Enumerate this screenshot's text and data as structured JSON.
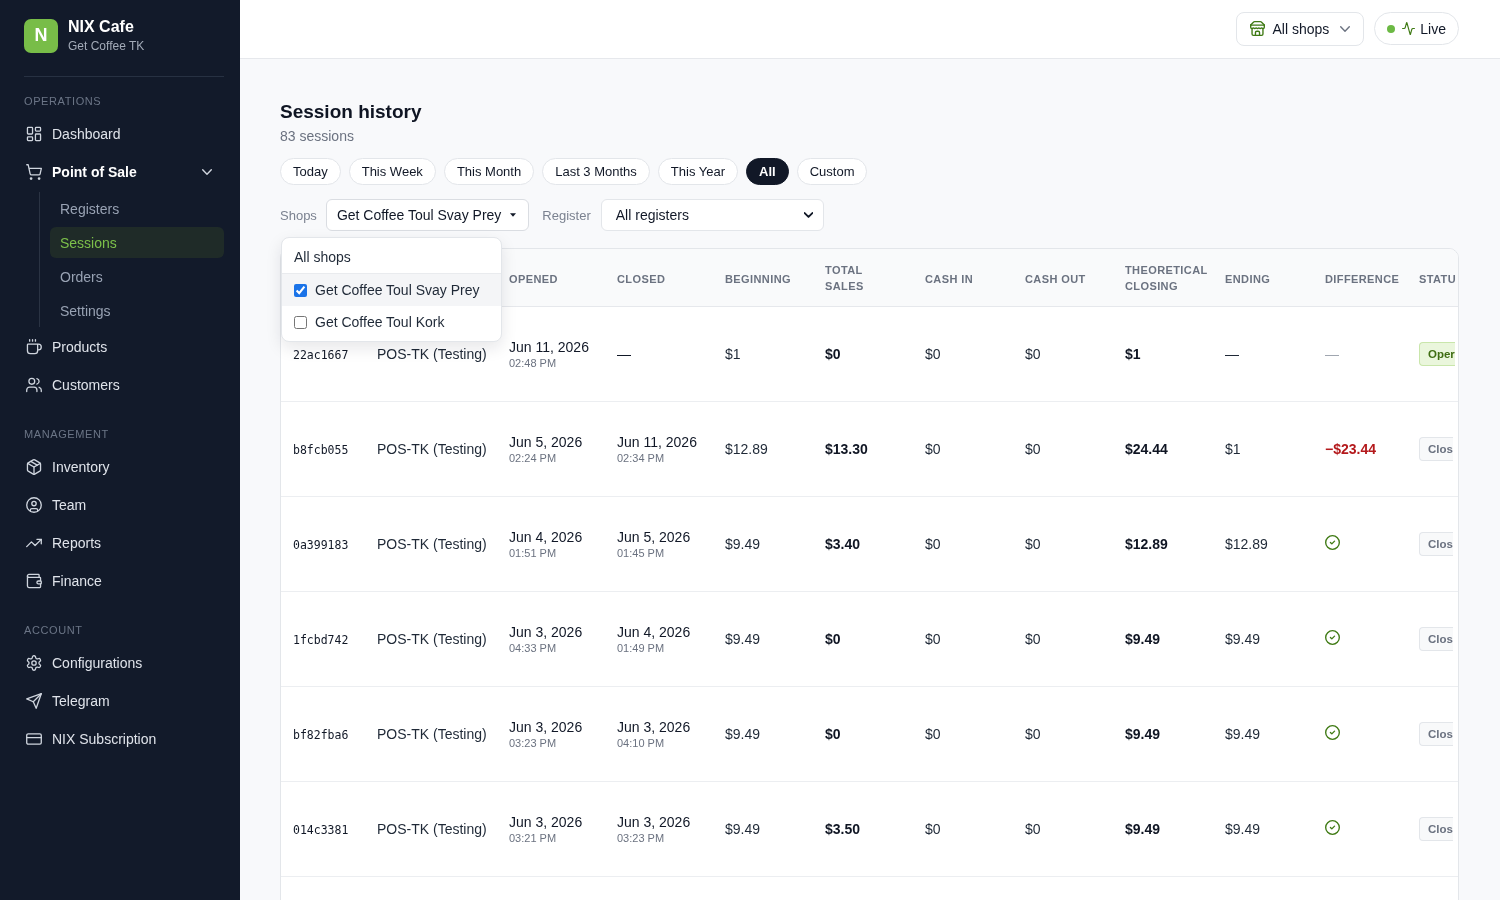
{
  "sidebar": {
    "brand": {
      "logo_letter": "N",
      "name": "NIX Cafe",
      "subtitle": "Get Coffee TK"
    },
    "sections": [
      {
        "heading": "OPERATIONS",
        "items": [
          {
            "label": "Dashboard",
            "selected": false
          },
          {
            "label": "Point of Sale",
            "selected": false,
            "expanded": true,
            "children": [
              {
                "label": "Registers",
                "selected": false
              },
              {
                "label": "Sessions",
                "selected": true
              },
              {
                "label": "Orders",
                "selected": false
              },
              {
                "label": "Settings",
                "selected": false
              }
            ]
          },
          {
            "label": "Products",
            "selected": false
          },
          {
            "label": "Customers",
            "selected": false
          }
        ]
      },
      {
        "heading": "MANAGEMENT",
        "items": [
          {
            "label": "Inventory",
            "selected": false
          },
          {
            "label": "Team",
            "selected": false
          },
          {
            "label": "Reports",
            "selected": false
          },
          {
            "label": "Finance",
            "selected": false
          }
        ]
      },
      {
        "heading": "ACCOUNT",
        "items": [
          {
            "label": "Configurations",
            "selected": false
          },
          {
            "label": "Telegram",
            "selected": false
          },
          {
            "label": "NIX Subscription",
            "selected": false
          }
        ]
      }
    ]
  },
  "header": {
    "shop_switcher": {
      "label": "All shops"
    },
    "live_indicator": {
      "label": "Live",
      "connected": true
    }
  },
  "page": {
    "title": "Session history",
    "subtitle": "83 sessions"
  },
  "date_ranges": [
    {
      "label": "Today",
      "selected": false
    },
    {
      "label": "This Week",
      "selected": false
    },
    {
      "label": "This Month",
      "selected": false
    },
    {
      "label": "Last 3 Months",
      "selected": false
    },
    {
      "label": "This Year",
      "selected": false
    },
    {
      "label": "All",
      "selected": true
    },
    {
      "label": "Custom",
      "selected": false
    }
  ],
  "filters": {
    "shops": {
      "label": "Shops",
      "value": "Get Coffee Toul Svay Prey",
      "expanded": true,
      "options": [
        {
          "kind": "all",
          "label": "All shops"
        },
        {
          "kind": "shop",
          "label": "Get Coffee Toul Svay Prey",
          "checked": true
        },
        {
          "kind": "shop",
          "label": "Get Coffee Toul Kork",
          "checked": false
        }
      ]
    },
    "register": {
      "label": "Register",
      "value": "All registers"
    }
  },
  "table": {
    "columns": [
      "OPENED",
      "CLOSED",
      "BEGINNING",
      "TOTAL SALES",
      "CASH IN",
      "CASH OUT",
      "THEORETICAL CLOSING",
      "ENDING",
      "DIFFERENCE",
      "STATU"
    ],
    "rows": [
      {
        "session": "22ac1667",
        "register": "POS-TK (Testing)",
        "opened": {
          "date": "Jun 11, 2026",
          "time": "02:48 PM"
        },
        "closed": {
          "date": "—"
        },
        "beginning": "$1",
        "total_sales": "$0",
        "cash_in": "$0",
        "cash_out": "$0",
        "theoretical_closing": "$1",
        "ending": "—",
        "difference": {
          "kind": "none",
          "text": "—"
        },
        "status": {
          "kind": "open",
          "label": "Oper"
        }
      },
      {
        "session": "b8fcb055",
        "register": "POS-TK (Testing)",
        "opened": {
          "date": "Jun 5, 2026",
          "time": "02:24 PM"
        },
        "closed": {
          "date": "Jun 11, 2026",
          "time": "02:34 PM"
        },
        "beginning": "$12.89",
        "total_sales": "$13.30",
        "cash_in": "$0",
        "cash_out": "$0",
        "theoretical_closing": "$24.44",
        "ending": "$1",
        "difference": {
          "kind": "shortfall",
          "text": "−$23.44"
        },
        "status": {
          "kind": "closed",
          "label": "Clos"
        }
      },
      {
        "session": "0a399183",
        "register": "POS-TK (Testing)",
        "opened": {
          "date": "Jun 4, 2026",
          "time": "01:51 PM"
        },
        "closed": {
          "date": "Jun 5, 2026",
          "time": "01:45 PM"
        },
        "beginning": "$9.49",
        "total_sales": "$3.40",
        "cash_in": "$0",
        "cash_out": "$0",
        "theoretical_closing": "$12.89",
        "ending": "$12.89",
        "difference": {
          "kind": "balanced"
        },
        "status": {
          "kind": "closed",
          "label": "Clos"
        }
      },
      {
        "session": "1fcbd742",
        "register": "POS-TK (Testing)",
        "opened": {
          "date": "Jun 3, 2026",
          "time": "04:33 PM"
        },
        "closed": {
          "date": "Jun 4, 2026",
          "time": "01:49 PM"
        },
        "beginning": "$9.49",
        "total_sales": "$0",
        "cash_in": "$0",
        "cash_out": "$0",
        "theoretical_closing": "$9.49",
        "ending": "$9.49",
        "difference": {
          "kind": "balanced"
        },
        "status": {
          "kind": "closed",
          "label": "Clos"
        }
      },
      {
        "session": "bf82fba6",
        "register": "POS-TK (Testing)",
        "opened": {
          "date": "Jun 3, 2026",
          "time": "03:23 PM"
        },
        "closed": {
          "date": "Jun 3, 2026",
          "time": "04:10 PM"
        },
        "beginning": "$9.49",
        "total_sales": "$0",
        "cash_in": "$0",
        "cash_out": "$0",
        "theoretical_closing": "$9.49",
        "ending": "$9.49",
        "difference": {
          "kind": "balanced"
        },
        "status": {
          "kind": "closed",
          "label": "Clos"
        }
      },
      {
        "session": "014c3381",
        "register": "POS-TK (Testing)",
        "opened": {
          "date": "Jun 3, 2026",
          "time": "03:21 PM"
        },
        "closed": {
          "date": "Jun 3, 2026",
          "time": "03:23 PM"
        },
        "beginning": "$9.49",
        "total_sales": "$3.50",
        "cash_in": "$0",
        "cash_out": "$0",
        "theoretical_closing": "$9.49",
        "ending": "$9.49",
        "difference": {
          "kind": "balanced"
        },
        "status": {
          "kind": "closed",
          "label": "Clos"
        }
      }
    ]
  }
}
